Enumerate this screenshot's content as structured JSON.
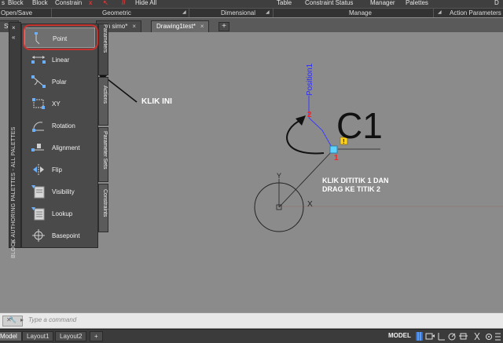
{
  "ribbon": {
    "top_labels": {
      "open_save_stub": "s",
      "block": "Block",
      "block2": "Block",
      "constrain": "Constrain",
      "hide_all": "Hide All",
      "table": "Table",
      "constraint_status": "Constraint Status",
      "manager": "Manager",
      "palettes": "Palettes",
      "d_stub": "D"
    },
    "panels": {
      "open_save": "Open/Save",
      "geometric": "Geometric",
      "dimensional": "Dimensional",
      "manage": "Manage",
      "action_parameters": "Action Parameters"
    }
  },
  "tabs": {
    "items": [
      "Sta",
      "om simo*",
      "Drawing1test*"
    ],
    "close_glyph": "×",
    "plus": "+"
  },
  "palette": {
    "title": "BLOCK AUTHORING PALETTES - ALL PALETTES",
    "items": [
      "Point",
      "Linear",
      "Polar",
      "XY",
      "Rotation",
      "Alignment",
      "Flip",
      "Visibility",
      "Lookup",
      "Basepoint"
    ],
    "tabs": [
      "Parameters",
      "Actions",
      "Parameter Sets",
      "Constraints"
    ],
    "controls": {
      "close": "×",
      "auto_hide": "«",
      "props": "≡"
    }
  },
  "annotations": {
    "klik_ini": "KLIK INI",
    "instruction_l1": "KLIK DITITIK 1 DAN",
    "instruction_l2": "DRAG KE TITIK 2",
    "c1": "C1"
  },
  "canvas": {
    "param_label": "Position1",
    "grip_1": "1",
    "grip_2": "2",
    "ucs_x": "X",
    "ucs_y": "Y",
    "warning": "!"
  },
  "command": {
    "placeholder": "Type a command",
    "close_glyph": "✕"
  },
  "status": {
    "tabs": [
      "Model",
      "Layout1",
      "Layout2"
    ],
    "plus": "+",
    "model_button": "MODEL"
  },
  "colors": {
    "accent_red": "#c8322e",
    "param_blue": "#3a3aff",
    "grip_red": "#ff2020",
    "grip_cyan": "#5fd3ff"
  }
}
